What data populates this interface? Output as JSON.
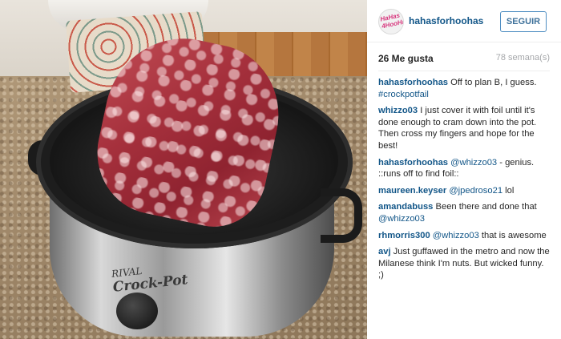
{
  "post": {
    "username": "hahasforhoohas",
    "avatar_text": "HaHas 4HooHas",
    "follow_label": "SEGUIR",
    "likes": "26 Me gusta",
    "time": "78 semana(s)"
  },
  "comments": [
    {
      "user": "hahasforhoohas",
      "text": "Off to plan B, I guess.",
      "tag": "#crockpotfail"
    },
    {
      "user": "whizzo03",
      "text": "I just cover it with foil until it's done enough to cram down into the pot. Then cross my fingers and hope for the best!"
    },
    {
      "user": "hahasforhoohas",
      "mention": "@whizzo03",
      "text": "- genius. ::runs off to find foil::"
    },
    {
      "user": "maureen.keyser",
      "mention": "@jpedroso21",
      "text": "lol"
    },
    {
      "user": "amandabuss",
      "text": "Been there and done that",
      "mention_after": "@whizzo03"
    },
    {
      "user": "rhmorris300",
      "mention": "@whizzo03",
      "text": "that is awesome"
    },
    {
      "user": "avj",
      "text": "Just guffawed in the metro and now the Milanese think I'm nuts. But wicked funny. ;)"
    }
  ],
  "photo": {
    "brand_top": "RIVAL",
    "brand_main": "Crock-Pot"
  },
  "colors": {
    "link": "#125688",
    "follow_border": "#4f8ec2",
    "muted": "#a5a7aa"
  }
}
